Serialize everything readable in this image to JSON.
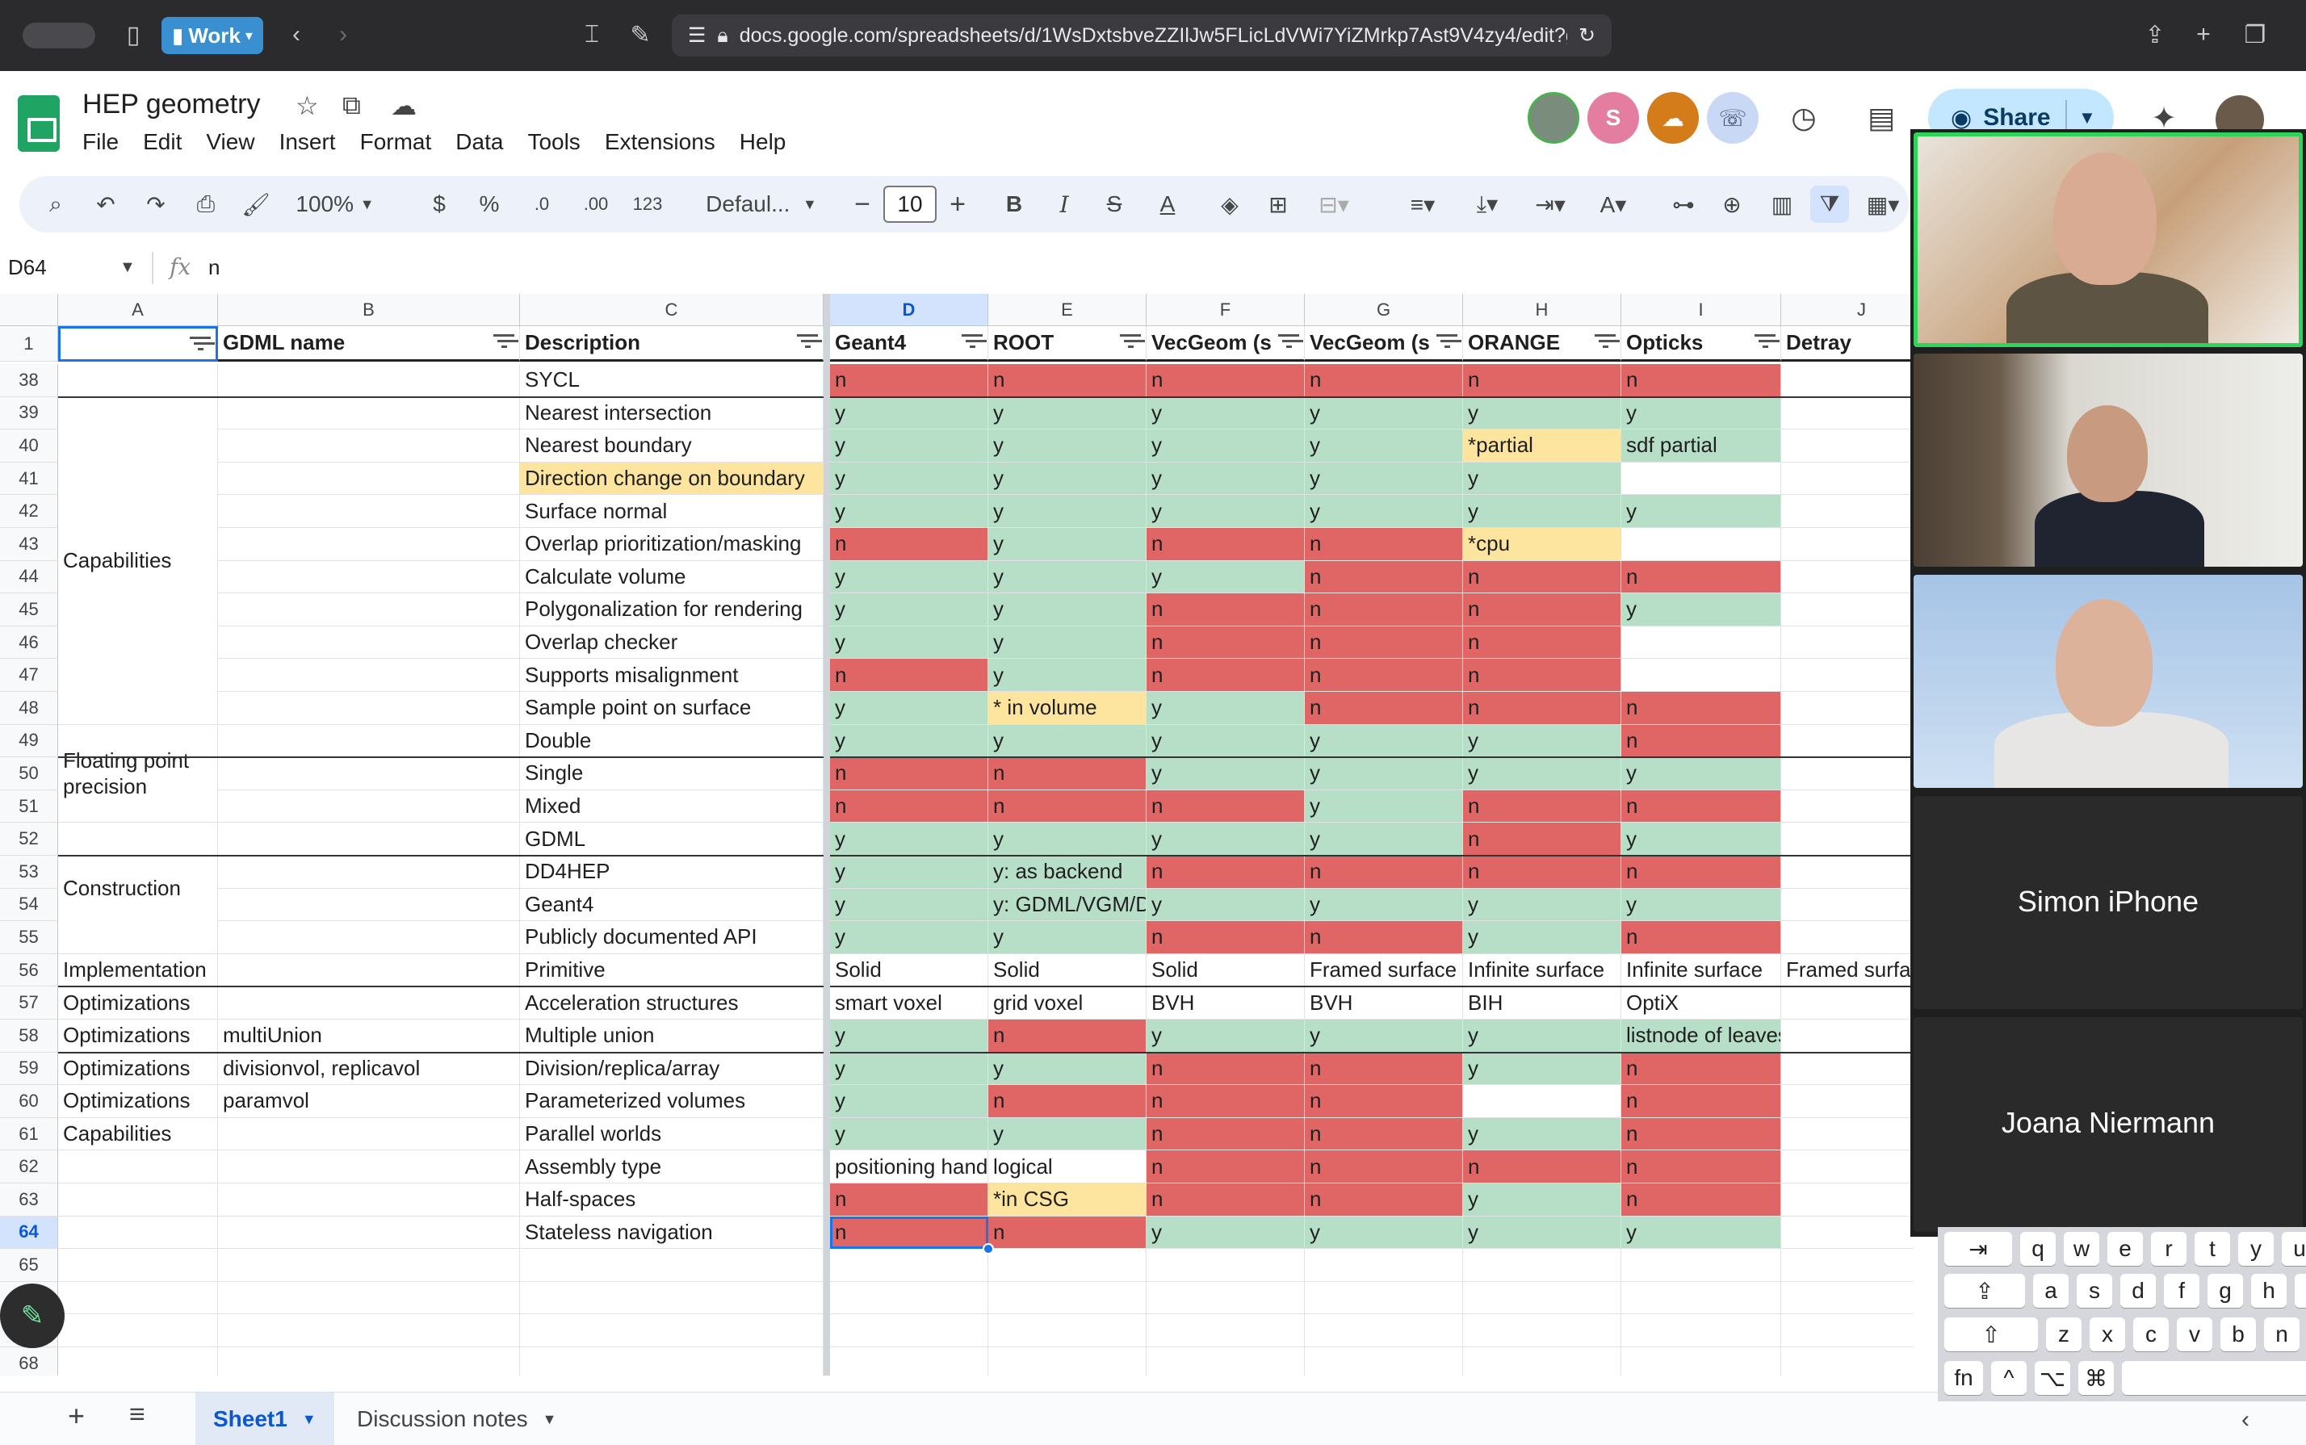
{
  "browser": {
    "profile_label": "Work",
    "url": "docs.google.com/spreadsheets/d/1WsDxtsbveZZIlJw5FLicLdVWi7YiZMrkp7Ast9V4zy4/edit?gid="
  },
  "document": {
    "title": "HEP geometry",
    "menu": [
      "File",
      "Edit",
      "View",
      "Insert",
      "Format",
      "Data",
      "Tools",
      "Extensions",
      "Help"
    ],
    "collaborator_initial": "S",
    "share_label": "Share"
  },
  "toolbar": {
    "zoom": "100%",
    "currency": "$",
    "percent": "%",
    "dec_decrease": ".0",
    "dec_increase": ".00",
    "number_format": "123",
    "font": "Defaul...",
    "font_size": "10"
  },
  "formula_bar": {
    "cell_ref": "D64",
    "value": "n"
  },
  "grid": {
    "columns": [
      "A",
      "B",
      "C",
      "D",
      "E",
      "F",
      "G",
      "H",
      "I",
      "J"
    ],
    "selected_column": "D",
    "selected_row": "64",
    "header_row": {
      "row": "1",
      "cells": [
        "",
        "GDML name",
        "Description",
        "Geant4",
        "ROOT",
        "VecGeom (s",
        "VecGeom (s",
        "ORANGE",
        "Opticks",
        "Detray"
      ]
    },
    "groups": [
      {
        "label": "Capabilities"
      },
      {
        "label": "Floating point precision"
      },
      {
        "label": "Construction"
      }
    ],
    "rows": [
      {
        "num": "38",
        "a": "",
        "b": "",
        "c": "SYCL",
        "cells": [
          "n",
          "n",
          "n",
          "n",
          "n",
          "n"
        ],
        "colors": [
          "red",
          "red",
          "red",
          "red",
          "red",
          "red"
        ]
      },
      {
        "num": "39",
        "a": "",
        "b": "",
        "c": "Nearest intersection",
        "cells": [
          "y",
          "y",
          "y",
          "y",
          "y",
          "y"
        ],
        "colors": [
          "grn",
          "grn",
          "grn",
          "grn",
          "grn",
          "grn"
        ]
      },
      {
        "num": "40",
        "a": "",
        "b": "",
        "c": "Nearest boundary",
        "cells": [
          "y",
          "y",
          "y",
          "y",
          "*partial",
          "sdf partial"
        ],
        "colors": [
          "grn",
          "grn",
          "grn",
          "grn",
          "ylw",
          "grn"
        ]
      },
      {
        "num": "41",
        "a": "",
        "b": "",
        "c": "Direction change on boundary",
        "c_color": "ylw",
        "cells": [
          "y",
          "y",
          "y",
          "y",
          "y",
          ""
        ],
        "colors": [
          "grn",
          "grn",
          "grn",
          "grn",
          "grn",
          "wht"
        ]
      },
      {
        "num": "42",
        "a": "",
        "b": "",
        "c": "Surface normal",
        "cells": [
          "y",
          "y",
          "y",
          "y",
          "y",
          "y"
        ],
        "colors": [
          "grn",
          "grn",
          "grn",
          "grn",
          "grn",
          "grn"
        ]
      },
      {
        "num": "43",
        "a": "",
        "b": "",
        "c": "Overlap prioritization/masking",
        "cells": [
          "n",
          "y",
          "n",
          "n",
          "*cpu",
          ""
        ],
        "colors": [
          "red",
          "grn",
          "red",
          "red",
          "ylw",
          "wht"
        ]
      },
      {
        "num": "44",
        "a": "",
        "b": "",
        "c": "Calculate volume",
        "cells": [
          "y",
          "y",
          "y",
          "n",
          "n",
          "n"
        ],
        "colors": [
          "grn",
          "grn",
          "grn",
          "red",
          "red",
          "red"
        ]
      },
      {
        "num": "45",
        "a": "",
        "b": "",
        "c": "Polygonalization for rendering",
        "cells": [
          "y",
          "y",
          "n",
          "n",
          "n",
          "y"
        ],
        "colors": [
          "grn",
          "grn",
          "red",
          "red",
          "red",
          "grn"
        ]
      },
      {
        "num": "46",
        "a": "",
        "b": "",
        "c": "Overlap checker",
        "cells": [
          "y",
          "y",
          "n",
          "n",
          "n",
          ""
        ],
        "colors": [
          "grn",
          "grn",
          "red",
          "red",
          "red",
          "wht"
        ]
      },
      {
        "num": "47",
        "a": "",
        "b": "",
        "c": "Supports misalignment",
        "cells": [
          "n",
          "y",
          "n",
          "n",
          "n",
          ""
        ],
        "colors": [
          "red",
          "grn",
          "red",
          "red",
          "red",
          "wht"
        ]
      },
      {
        "num": "48",
        "a": "",
        "b": "",
        "c": "Sample point on surface",
        "cells": [
          "y",
          "* in volume",
          "y",
          "n",
          "n",
          "n"
        ],
        "colors": [
          "grn",
          "ylw",
          "grn",
          "red",
          "red",
          "red"
        ]
      },
      {
        "num": "49",
        "a": "",
        "b": "",
        "c": "Double",
        "cells": [
          "y",
          "y",
          "y",
          "y",
          "y",
          "n"
        ],
        "colors": [
          "grn",
          "grn",
          "grn",
          "grn",
          "grn",
          "red"
        ]
      },
      {
        "num": "50",
        "a": "",
        "b": "",
        "c": "Single",
        "cells": [
          "n",
          "n",
          "y",
          "y",
          "y",
          "y"
        ],
        "colors": [
          "red",
          "red",
          "grn",
          "grn",
          "grn",
          "grn"
        ]
      },
      {
        "num": "51",
        "a": "",
        "b": "",
        "c": "Mixed",
        "cells": [
          "n",
          "n",
          "n",
          "y",
          "n",
          "n"
        ],
        "colors": [
          "red",
          "red",
          "red",
          "grn",
          "red",
          "red"
        ]
      },
      {
        "num": "52",
        "a": "",
        "b": "",
        "c": "GDML",
        "cells": [
          "y",
          "y",
          "y",
          "y",
          "n",
          "y"
        ],
        "colors": [
          "grn",
          "grn",
          "grn",
          "grn",
          "red",
          "grn"
        ]
      },
      {
        "num": "53",
        "a": "",
        "b": "",
        "c": "DD4HEP",
        "cells": [
          "y",
          "y: as backend",
          "n",
          "n",
          "n",
          "n"
        ],
        "colors": [
          "grn",
          "grn",
          "red",
          "red",
          "red",
          "red"
        ]
      },
      {
        "num": "54",
        "a": "",
        "b": "",
        "c": "Geant4",
        "cells": [
          "y",
          "y: GDML/VGM/D",
          "y",
          "y",
          "y",
          "y"
        ],
        "colors": [
          "grn",
          "grn",
          "grn",
          "grn",
          "grn",
          "grn"
        ]
      },
      {
        "num": "55",
        "a": "",
        "b": "",
        "c": "Publicly documented API",
        "cells": [
          "y",
          "y",
          "n",
          "n",
          "y",
          "n"
        ],
        "colors": [
          "grn",
          "grn",
          "red",
          "red",
          "grn",
          "red"
        ]
      },
      {
        "num": "56",
        "a": "Implementation",
        "b": "",
        "c": "Primitive",
        "cells": [
          "Solid",
          "Solid",
          "Solid",
          "Framed surface",
          "Infinite surface",
          "Infinite surface",
          "Framed surfa"
        ],
        "colors": [
          "",
          "",
          "",
          "",
          "",
          "",
          ""
        ]
      },
      {
        "num": "57",
        "a": "Optimizations",
        "b": "",
        "c": "Acceleration structures",
        "cells": [
          "smart voxel",
          "grid voxel",
          "BVH",
          "BVH",
          "BIH",
          "OptiX"
        ],
        "colors": [
          "",
          "",
          "",
          "",
          "",
          ""
        ]
      },
      {
        "num": "58",
        "a": "Optimizations",
        "b": "multiUnion",
        "c": "Multiple union",
        "cells": [
          "y",
          "n",
          "y",
          "y",
          "y",
          "listnode of leaves"
        ],
        "colors": [
          "grn",
          "red",
          "grn",
          "grn",
          "grn",
          "grn"
        ]
      },
      {
        "num": "59",
        "a": "Optimizations",
        "b": "divisionvol, replicavol",
        "c": "Division/replica/array",
        "cells": [
          "y",
          "y",
          "n",
          "n",
          "y",
          "n"
        ],
        "colors": [
          "grn",
          "grn",
          "red",
          "red",
          "grn",
          "red"
        ]
      },
      {
        "num": "60",
        "a": "Optimizations",
        "b": "paramvol",
        "c": "Parameterized volumes",
        "cells": [
          "y",
          "n",
          "n",
          "n",
          "",
          "n"
        ],
        "colors": [
          "grn",
          "red",
          "red",
          "red",
          "wht",
          "red"
        ]
      },
      {
        "num": "61",
        "a": "Capabilities",
        "b": "",
        "c": "Parallel worlds",
        "cells": [
          "y",
          "y",
          "n",
          "n",
          "y",
          "n"
        ],
        "colors": [
          "grn",
          "grn",
          "red",
          "red",
          "grn",
          "red"
        ]
      },
      {
        "num": "62",
        "a": "",
        "b": "",
        "c": "Assembly type",
        "cells": [
          "positioning hand",
          "logical",
          "n",
          "n",
          "n",
          "n"
        ],
        "colors": [
          "",
          "",
          "red",
          "red",
          "red",
          "red"
        ]
      },
      {
        "num": "63",
        "a": "",
        "b": "",
        "c": "Half-spaces",
        "cells": [
          "n",
          "*in CSG",
          "n",
          "n",
          "y",
          "n"
        ],
        "colors": [
          "red",
          "ylw",
          "red",
          "red",
          "grn",
          "red"
        ]
      },
      {
        "num": "64",
        "a": "",
        "b": "",
        "c": "Stateless navigation",
        "cells": [
          "n",
          "n",
          "y",
          "y",
          "y",
          "y"
        ],
        "colors": [
          "red",
          "red",
          "grn",
          "grn",
          "grn",
          "grn"
        ]
      },
      {
        "num": "65",
        "a": "",
        "b": "",
        "c": "",
        "cells": [],
        "colors": []
      },
      {
        "num": "",
        "a": "",
        "b": "",
        "c": "",
        "cells": [],
        "colors": []
      },
      {
        "num": "",
        "a": "",
        "b": "",
        "c": "",
        "cells": [],
        "colors": []
      },
      {
        "num": "68",
        "a": "",
        "b": "",
        "c": "",
        "cells": [],
        "colors": []
      }
    ]
  },
  "sheet_tabs": [
    {
      "label": "Sheet1",
      "active": true
    },
    {
      "label": "Discussion notes",
      "active": false
    }
  ],
  "video_call": {
    "participants": [
      {
        "name": "",
        "speaking": true
      },
      {
        "name": ""
      },
      {
        "name": ""
      },
      {
        "name": "Simon iPhone"
      },
      {
        "name": "Joana Niermann"
      }
    ]
  },
  "keyboard": {
    "rows": [
      [
        "⇥",
        "q",
        "w",
        "e",
        "r",
        "t",
        "y",
        "u"
      ],
      [
        "⇪",
        "a",
        "s",
        "d",
        "f",
        "g",
        "h",
        "j"
      ],
      [
        "⇧",
        "z",
        "x",
        "c",
        "v",
        "b",
        "n"
      ],
      [
        "fn",
        "^",
        "⌥",
        "⌘",
        ""
      ]
    ]
  },
  "colors": {
    "green": "#b7dfc8",
    "red": "#e06666",
    "yellow": "#fde59f",
    "accent": "#1a73e8",
    "speaking_border": "#2fd45a"
  }
}
